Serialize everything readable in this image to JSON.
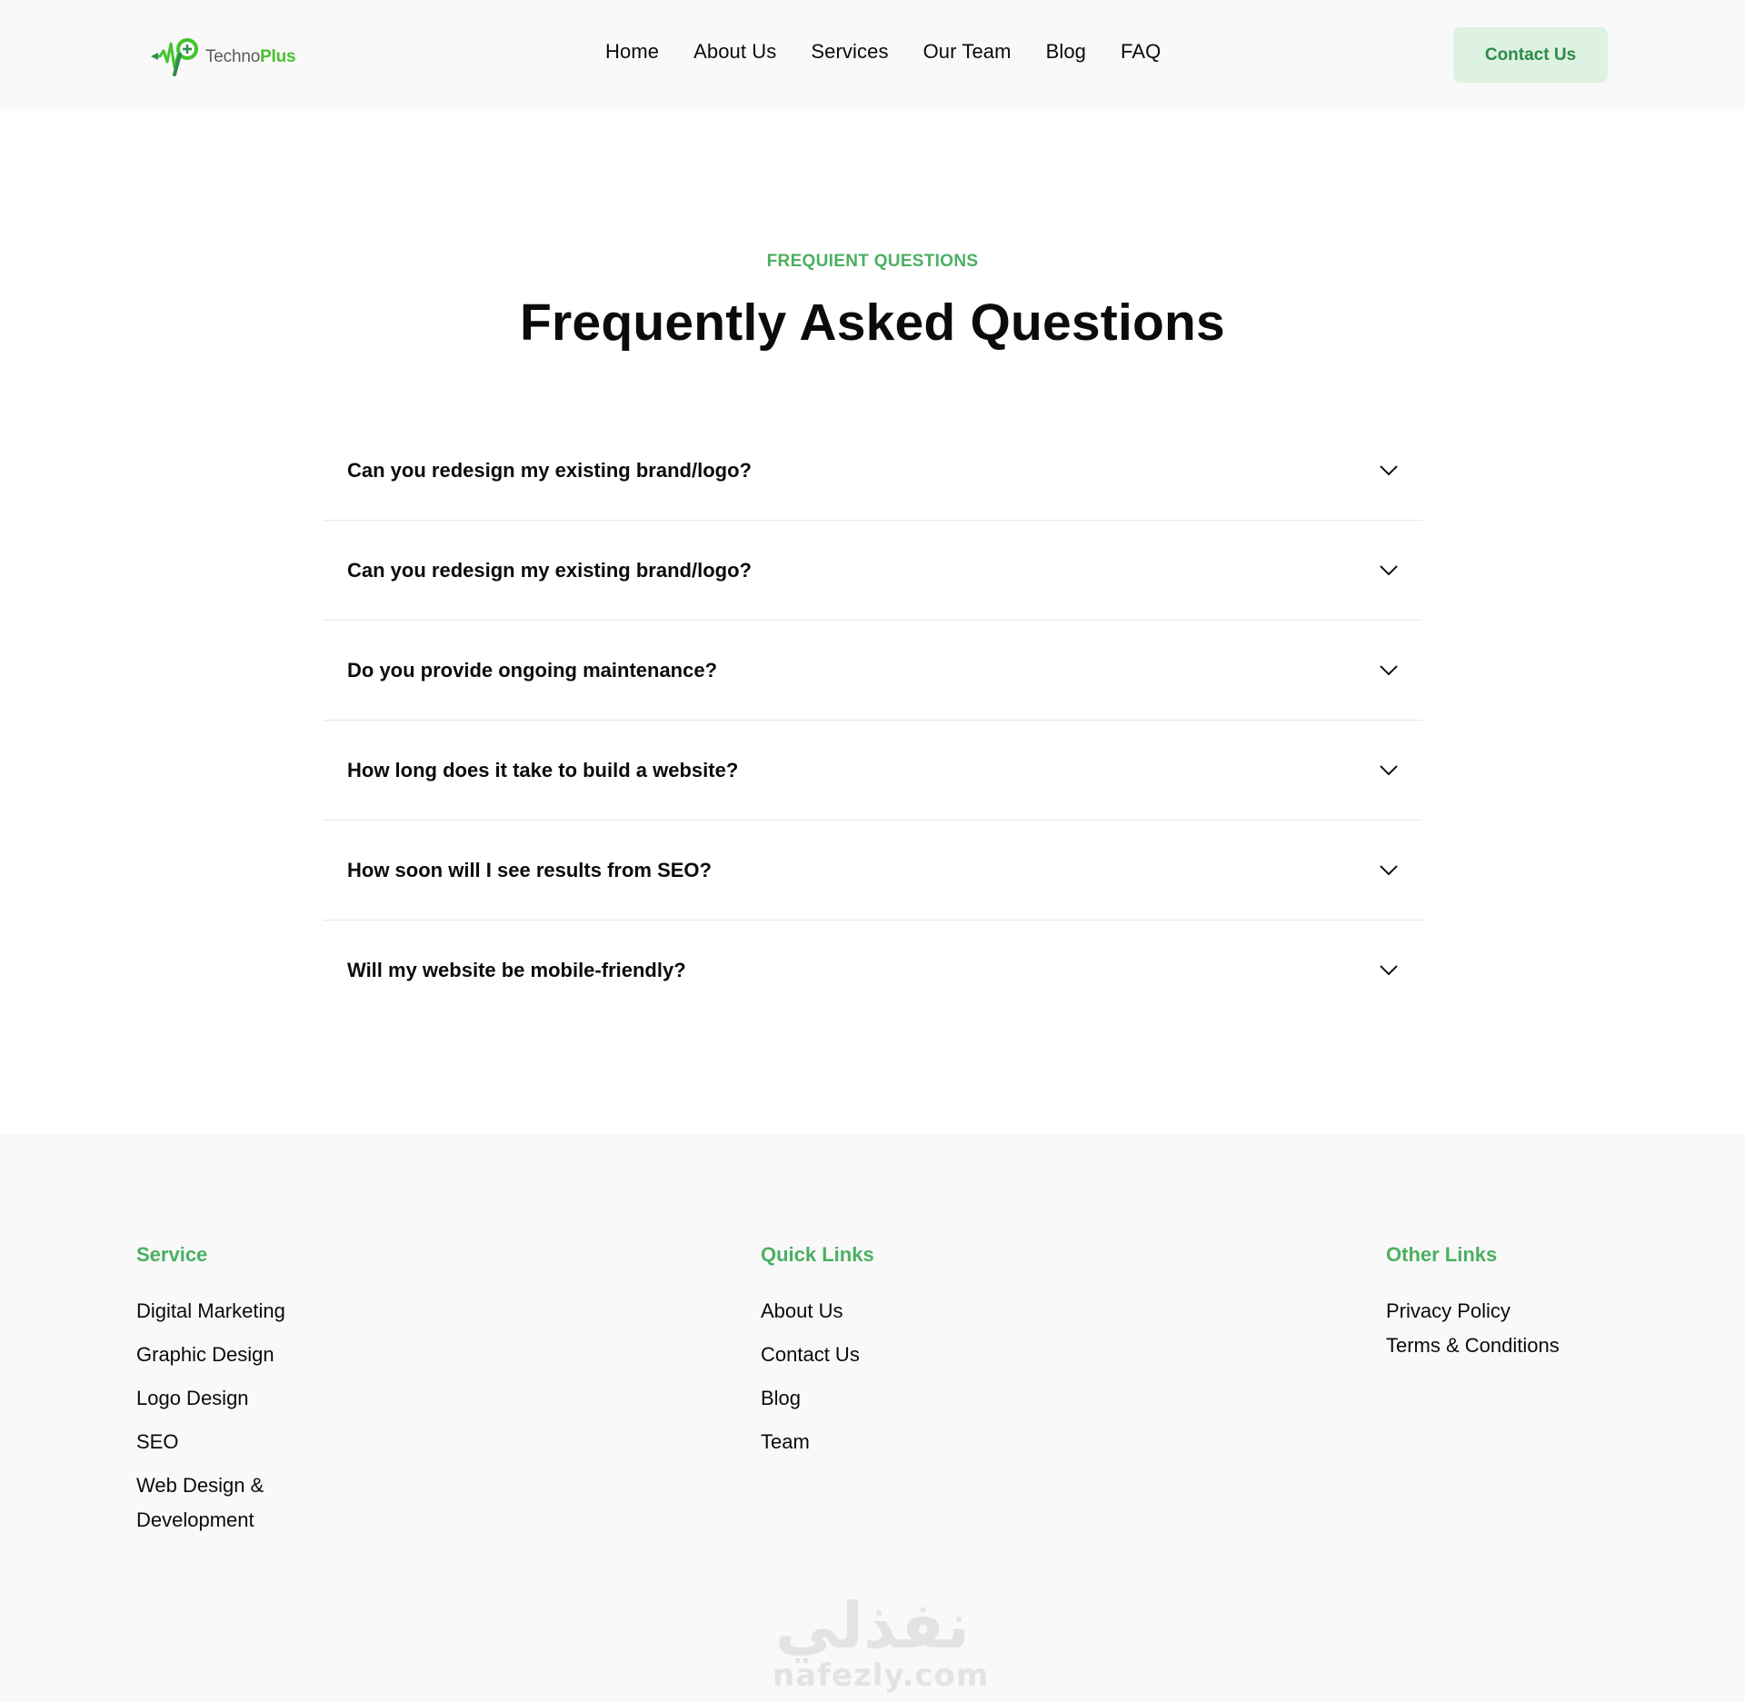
{
  "header": {
    "logo": {
      "text_main": "Techno",
      "text_accent": "Plus"
    },
    "nav": [
      {
        "label": "Home"
      },
      {
        "label": "About Us"
      },
      {
        "label": "Services"
      },
      {
        "label": "Our Team"
      },
      {
        "label": "Blog"
      },
      {
        "label": "FAQ"
      }
    ],
    "cta_label": "Contact Us"
  },
  "faq": {
    "eyebrow": "FREQUIENT QUESTIONS",
    "title": "Frequently Asked Questions",
    "items": [
      {
        "question": "Can you redesign my existing brand/logo?",
        "icon": "chevron-down-icon"
      },
      {
        "question": "Can you redesign my existing brand/logo?",
        "icon": "chevron-down-icon"
      },
      {
        "question": "Do you provide ongoing maintenance?",
        "icon": "chevron-down-icon"
      },
      {
        "question": "How long does it take to build a website?",
        "icon": "chevron-down-icon"
      },
      {
        "question": "How soon will I see results from SEO?",
        "icon": "chevron-down-icon"
      },
      {
        "question": "Will my website be mobile-friendly?",
        "icon": "chevron-down-icon"
      }
    ]
  },
  "footer": {
    "service": {
      "heading": "Service",
      "links": [
        "Digital Marketing",
        "Graphic Design",
        "Logo Design",
        "SEO",
        "Web Design & Development"
      ]
    },
    "quick_links": {
      "heading": "Quick Links",
      "links": [
        "About Us",
        "Contact Us",
        "Blog",
        "Team"
      ]
    },
    "other_links": {
      "heading": "Other Links",
      "links": [
        "Privacy Policy",
        "Terms & Conditions"
      ]
    }
  },
  "watermark": {
    "arabic": "نفذلي",
    "latin": "nafezly.com"
  },
  "colors": {
    "accent_green": "#4caf62",
    "cta_bg": "#ddf2e2",
    "cta_text": "#2e8b4a",
    "logo_green": "#45c32f",
    "header_bg": "#f9f9f9",
    "footer_bg": "#f9f9f9",
    "text": "#0b0b0b",
    "divider": "#e6e6e6"
  }
}
